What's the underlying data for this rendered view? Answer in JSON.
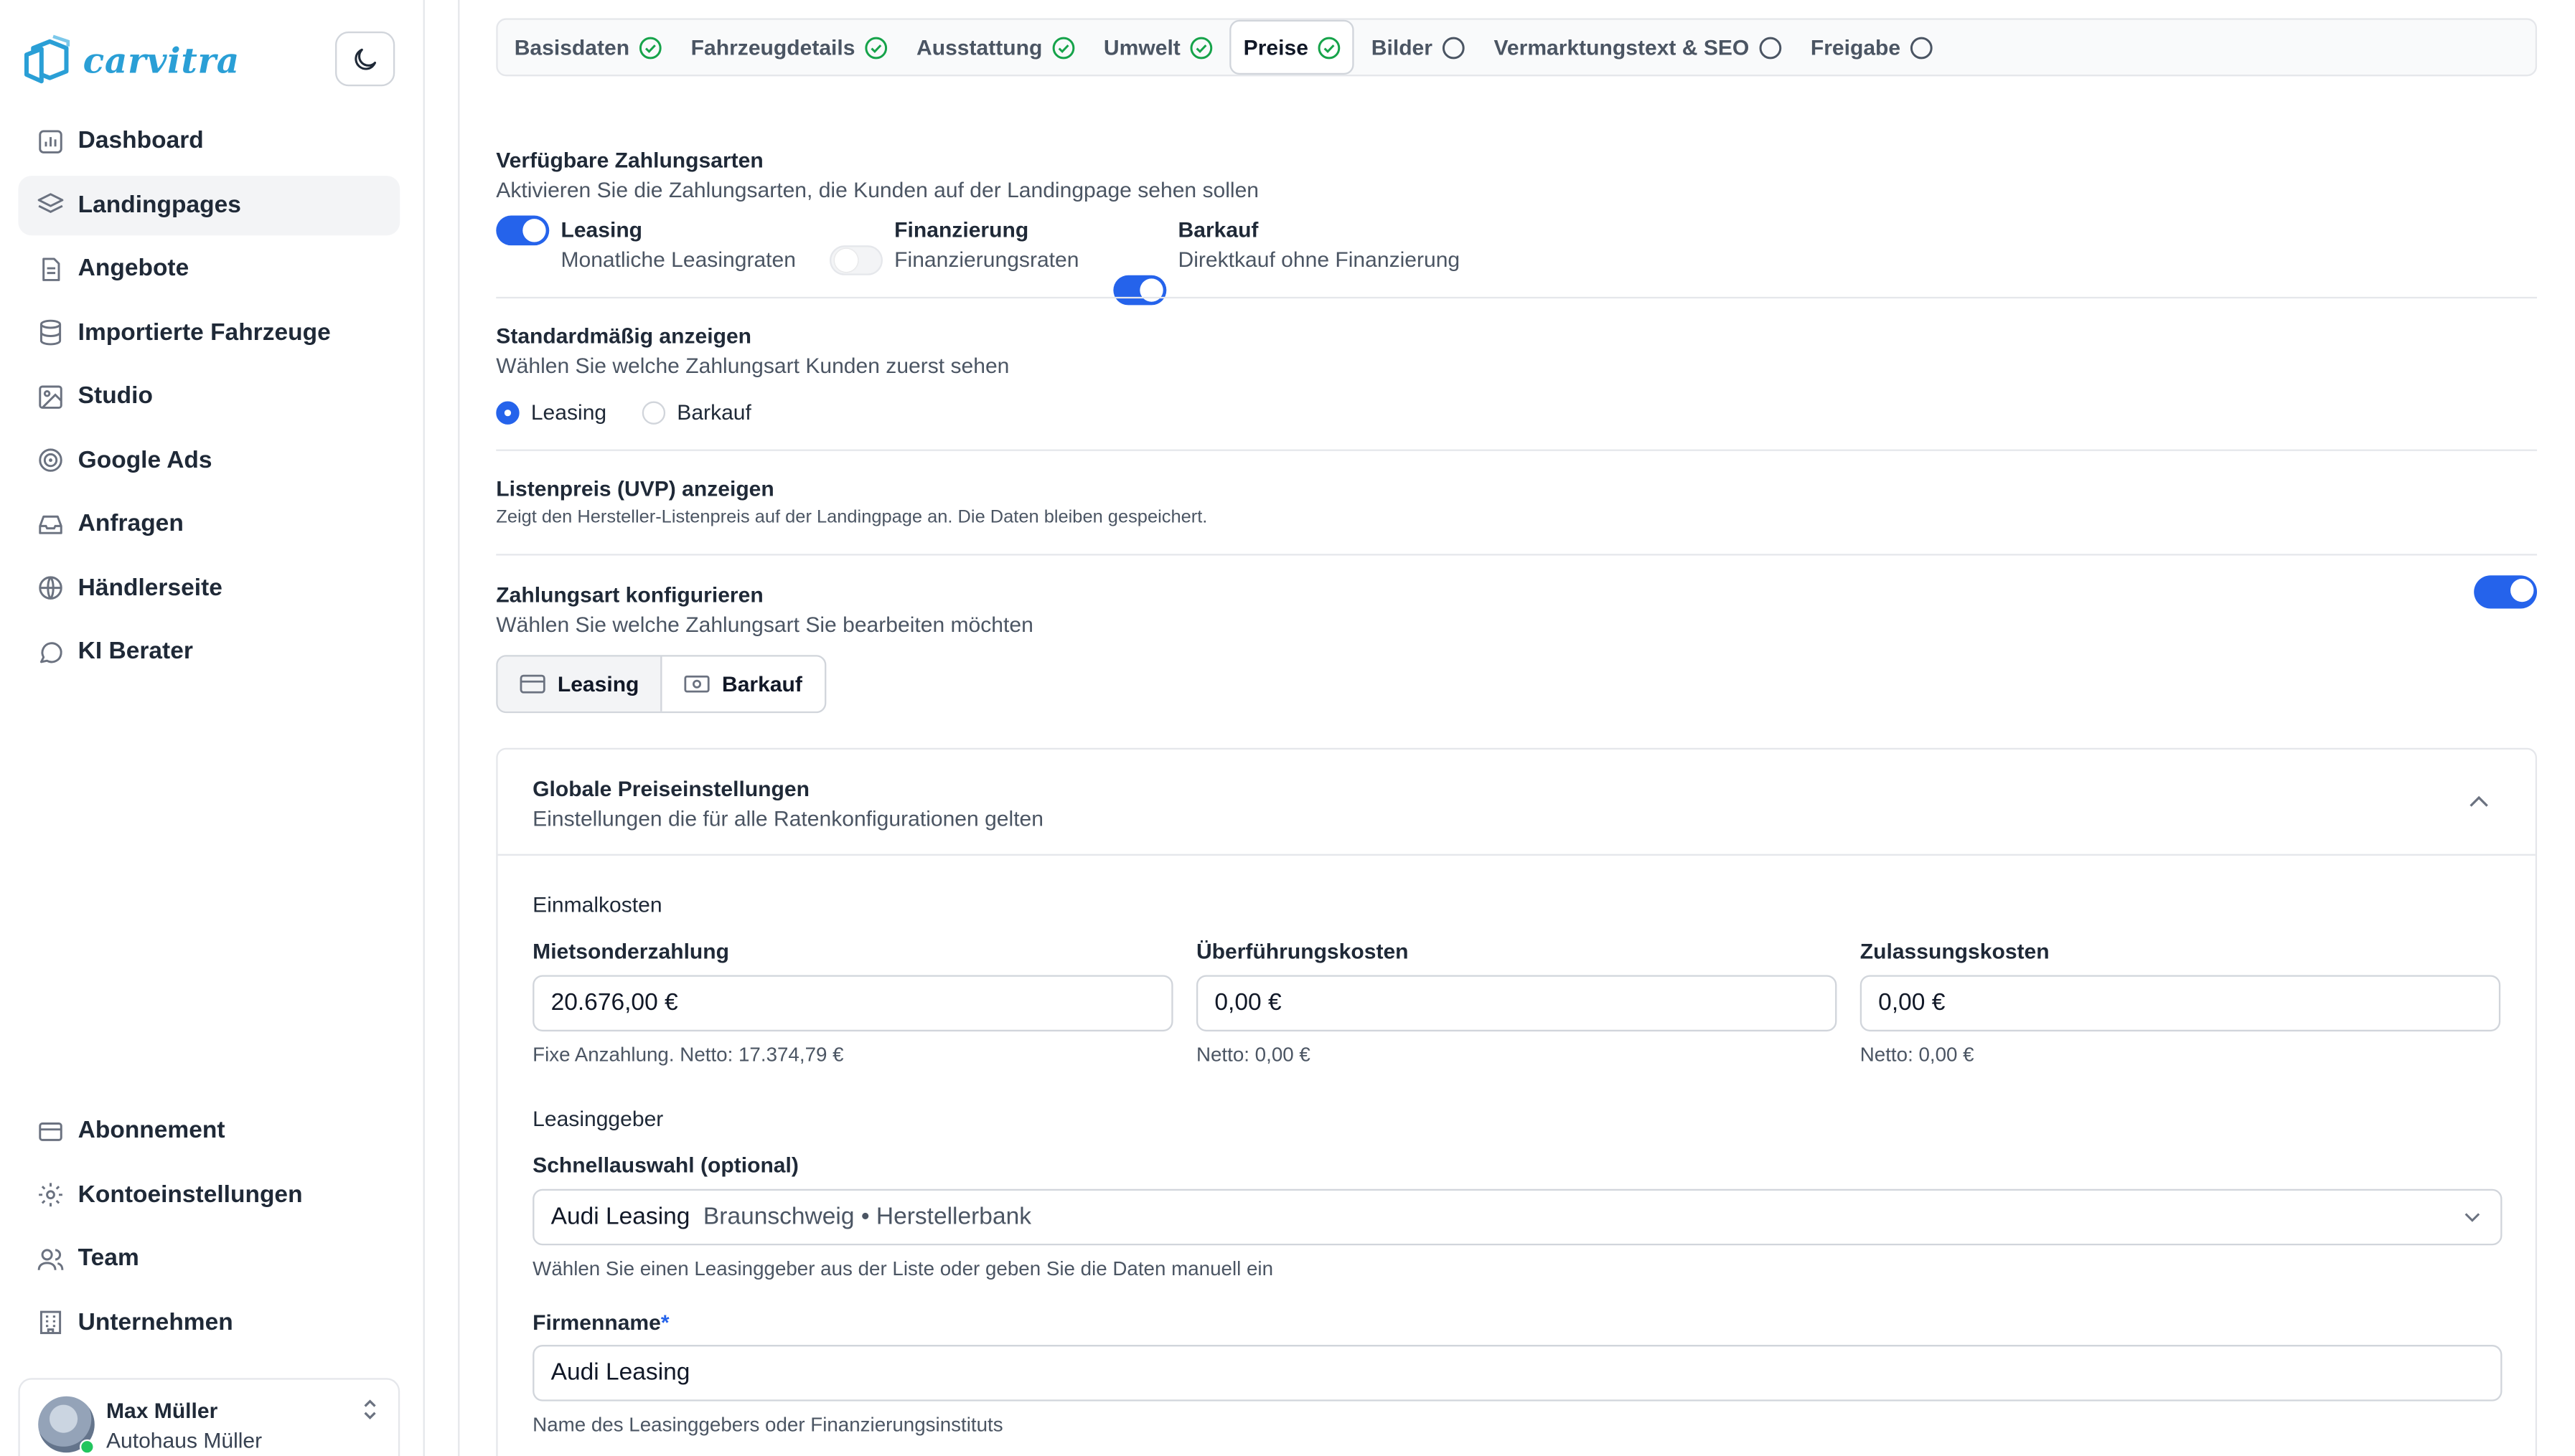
{
  "brand": {
    "name": "carvitra",
    "color": "#2a9fd6"
  },
  "sidebar": {
    "nav": [
      {
        "label": "Dashboard",
        "icon": "chart-icon"
      },
      {
        "label": "Landingpages",
        "icon": "layers-icon",
        "active": true
      },
      {
        "label": "Angebote",
        "icon": "document-icon"
      },
      {
        "label": "Importierte Fahrzeuge",
        "icon": "database-icon"
      },
      {
        "label": "Studio",
        "icon": "image-icon"
      },
      {
        "label": "Google Ads",
        "icon": "target-icon"
      },
      {
        "label": "Anfragen",
        "icon": "inbox-icon"
      },
      {
        "label": "Händlerseite",
        "icon": "globe-icon"
      },
      {
        "label": "KI Berater",
        "icon": "chat-icon"
      }
    ],
    "bottom_nav": [
      {
        "label": "Abonnement",
        "icon": "credit-card-icon"
      },
      {
        "label": "Kontoeinstellungen",
        "icon": "gear-icon"
      },
      {
        "label": "Team",
        "icon": "users-icon"
      },
      {
        "label": "Unternehmen",
        "icon": "building-icon"
      }
    ],
    "user": {
      "name": "Max Müller",
      "company": "Autohaus Müller"
    }
  },
  "steps": [
    {
      "label": "Basisdaten",
      "done": true
    },
    {
      "label": "Fahrzeugdetails",
      "done": true
    },
    {
      "label": "Ausstattung",
      "done": true
    },
    {
      "label": "Umwelt",
      "done": true
    },
    {
      "label": "Preise",
      "done": true,
      "active": true
    },
    {
      "label": "Bilder",
      "done": false
    },
    {
      "label": "Vermarktungstext & SEO",
      "done": false
    },
    {
      "label": "Freigabe",
      "done": false
    }
  ],
  "payment": {
    "title": "Verfügbare Zahlungsarten",
    "desc": "Aktivieren Sie die Zahlungsarten, die Kunden auf der Landingpage sehen sollen",
    "options": [
      {
        "label": "Leasing",
        "desc": "Monatliche Leasingraten",
        "enabled": true
      },
      {
        "label": "Finanzierung",
        "desc": "Finanzierungsraten",
        "enabled": false
      },
      {
        "label": "Barkauf",
        "desc": "Direktkauf ohne Finanzierung",
        "enabled": true
      }
    ]
  },
  "default_display": {
    "title": "Standardmäßig anzeigen",
    "desc": "Wählen Sie welche Zahlungsart Kunden zuerst sehen",
    "options": [
      "Leasing",
      "Barkauf"
    ],
    "selected": "Leasing"
  },
  "list_price": {
    "title": "Listenpreis (UVP) anzeigen",
    "desc": "Zeigt den Hersteller-Listenpreis auf der Landingpage an. Die Daten bleiben gespeichert.",
    "enabled": true
  },
  "configure": {
    "title": "Zahlungsart konfigurieren",
    "desc": "Wählen Sie welche Zahlungsart Sie bearbeiten möchten",
    "tabs": [
      "Leasing",
      "Barkauf"
    ],
    "active": "Leasing"
  },
  "global": {
    "title": "Globale Preiseinstellungen",
    "desc": "Einstellungen die für alle Ratenkonfigurationen gelten",
    "once_title": "Einmalkosten",
    "fields": [
      {
        "label": "Mietsonderzahlung",
        "value": "20.676,00 €",
        "hint": "Fixe Anzahlung. Netto: 17.374,79 €"
      },
      {
        "label": "Überführungskosten",
        "value": "0,00 €",
        "hint": "Netto: 0,00 €"
      },
      {
        "label": "Zulassungskosten",
        "value": "0,00 €",
        "hint": "Netto: 0,00 €"
      }
    ],
    "lessor_title": "Leasinggeber",
    "quick_label": "Schnellauswahl (optional)",
    "quick_value": "Audi Leasing",
    "quick_meta": "Braunschweig • Herstellerbank",
    "quick_hint": "Wählen Sie einen Leasinggeber aus der Liste oder geben Sie die Daten manuell ein",
    "company_label": "Firmenname",
    "company_required": "*",
    "company_value": "Audi Leasing",
    "company_hint": "Name des Leasinggebers oder Finanzierungsinstituts"
  },
  "colors": {
    "accent": "#2563eb",
    "success": "#16a34a"
  }
}
